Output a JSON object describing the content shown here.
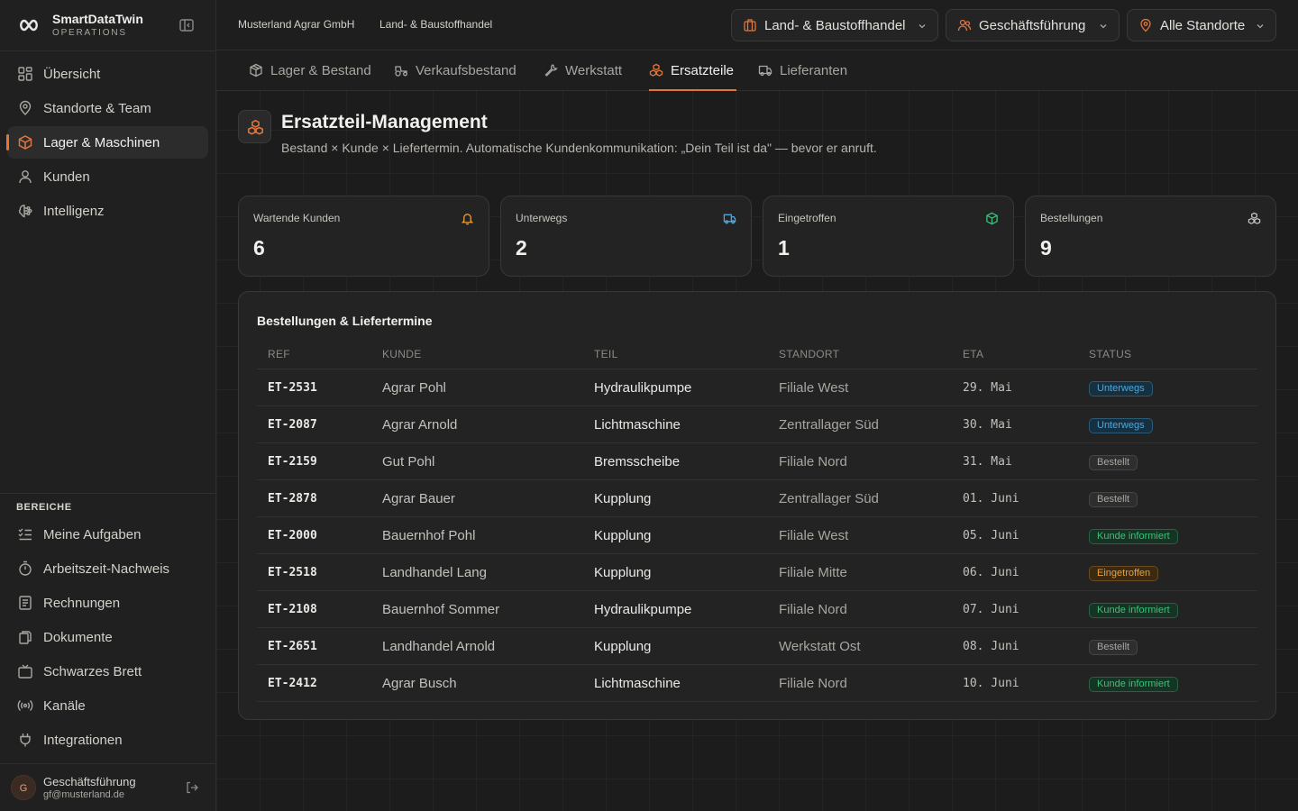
{
  "brand": {
    "name": "SmartDataTwin",
    "sub": "OPERATIONS"
  },
  "sidebar": {
    "items": [
      {
        "label": "Übersicht",
        "icon": "grid-icon"
      },
      {
        "label": "Standorte & Team",
        "icon": "map-pin-icon"
      },
      {
        "label": "Lager & Maschinen",
        "icon": "box-icon",
        "active": true
      },
      {
        "label": "Kunden",
        "icon": "user-icon"
      },
      {
        "label": "Intelligenz",
        "icon": "brain-icon"
      }
    ],
    "section_title": "BEREICHE",
    "section_items": [
      {
        "label": "Meine Aufgaben",
        "icon": "tasks-icon"
      },
      {
        "label": "Arbeitszeit-Nachweis",
        "icon": "timer-icon"
      },
      {
        "label": "Rechnungen",
        "icon": "invoice-icon"
      },
      {
        "label": "Dokumente",
        "icon": "documents-icon"
      },
      {
        "label": "Schwarzes Brett",
        "icon": "tv-board-icon"
      },
      {
        "label": "Kanäle",
        "icon": "broadcast-icon"
      },
      {
        "label": "Integrationen",
        "icon": "plug-icon"
      }
    ],
    "user": {
      "initial": "G",
      "name": "Geschäftsführung",
      "email": "gf@musterland.de"
    }
  },
  "header": {
    "breadcrumb": [
      "Musterland Agrar GmbH",
      "Land- & Baustoffhandel"
    ],
    "dropdowns": [
      {
        "label": "Land- & Baustoffhandel",
        "icon": "store-icon"
      },
      {
        "label": "Geschäftsführung",
        "icon": "users-icon"
      },
      {
        "label": "Alle Standorte",
        "icon": "map-pin-icon"
      }
    ]
  },
  "tabs": [
    {
      "label": "Lager & Bestand",
      "icon": "package-icon"
    },
    {
      "label": "Verkaufsbestand",
      "icon": "tractor-icon"
    },
    {
      "label": "Werkstatt",
      "icon": "wrench-icon"
    },
    {
      "label": "Ersatzteile",
      "icon": "boxes-icon",
      "active": true
    },
    {
      "label": "Lieferanten",
      "icon": "truck-icon"
    }
  ],
  "page": {
    "title": "Ersatzteil-Management",
    "subtitle": "Bestand × Kunde × Liefertermin. Automatische Kundenkommunikation: „Dein Teil ist da\" — bevor er anruft."
  },
  "stats": [
    {
      "label": "Wartende Kunden",
      "value": "6",
      "icon": "bell-icon",
      "color": "#e8a03a"
    },
    {
      "label": "Unterwegs",
      "value": "2",
      "icon": "truck-icon",
      "color": "#4aa8e0"
    },
    {
      "label": "Eingetroffen",
      "value": "1",
      "icon": "package-check-icon",
      "color": "#3cc07a"
    },
    {
      "label": "Bestellungen",
      "value": "9",
      "icon": "boxes-icon",
      "color": "#c8c5bf"
    }
  ],
  "table": {
    "title": "Bestellungen & Liefertermine",
    "headers": [
      "REF",
      "KUNDE",
      "TEIL",
      "STANDORT",
      "ETA",
      "STATUS"
    ],
    "rows": [
      {
        "ref": "ET-2531",
        "kunde": "Agrar Pohl",
        "teil": "Hydraulikpumpe",
        "standort": "Filiale West",
        "eta": "29. Mai",
        "status": "Unterwegs"
      },
      {
        "ref": "ET-2087",
        "kunde": "Agrar Arnold",
        "teil": "Lichtmaschine",
        "standort": "Zentrallager Süd",
        "eta": "30. Mai",
        "status": "Unterwegs"
      },
      {
        "ref": "ET-2159",
        "kunde": "Gut Pohl",
        "teil": "Bremsscheibe",
        "standort": "Filiale Nord",
        "eta": "31. Mai",
        "status": "Bestellt"
      },
      {
        "ref": "ET-2878",
        "kunde": "Agrar Bauer",
        "teil": "Kupplung",
        "standort": "Zentrallager Süd",
        "eta": "01. Juni",
        "status": "Bestellt"
      },
      {
        "ref": "ET-2000",
        "kunde": "Bauernhof Pohl",
        "teil": "Kupplung",
        "standort": "Filiale West",
        "eta": "05. Juni",
        "status": "Kunde informiert"
      },
      {
        "ref": "ET-2518",
        "kunde": "Landhandel Lang",
        "teil": "Kupplung",
        "standort": "Filiale Mitte",
        "eta": "06. Juni",
        "status": "Eingetroffen"
      },
      {
        "ref": "ET-2108",
        "kunde": "Bauernhof Sommer",
        "teil": "Hydraulikpumpe",
        "standort": "Filiale Nord",
        "eta": "07. Juni",
        "status": "Kunde informiert"
      },
      {
        "ref": "ET-2651",
        "kunde": "Landhandel Arnold",
        "teil": "Kupplung",
        "standort": "Werkstatt Ost",
        "eta": "08. Juni",
        "status": "Bestellt"
      },
      {
        "ref": "ET-2412",
        "kunde": "Agrar Busch",
        "teil": "Lichtmaschine",
        "standort": "Filiale Nord",
        "eta": "10. Juni",
        "status": "Kunde informiert"
      }
    ]
  },
  "colors": {
    "accent": "#e0763c",
    "background": "#1c1c1c"
  }
}
